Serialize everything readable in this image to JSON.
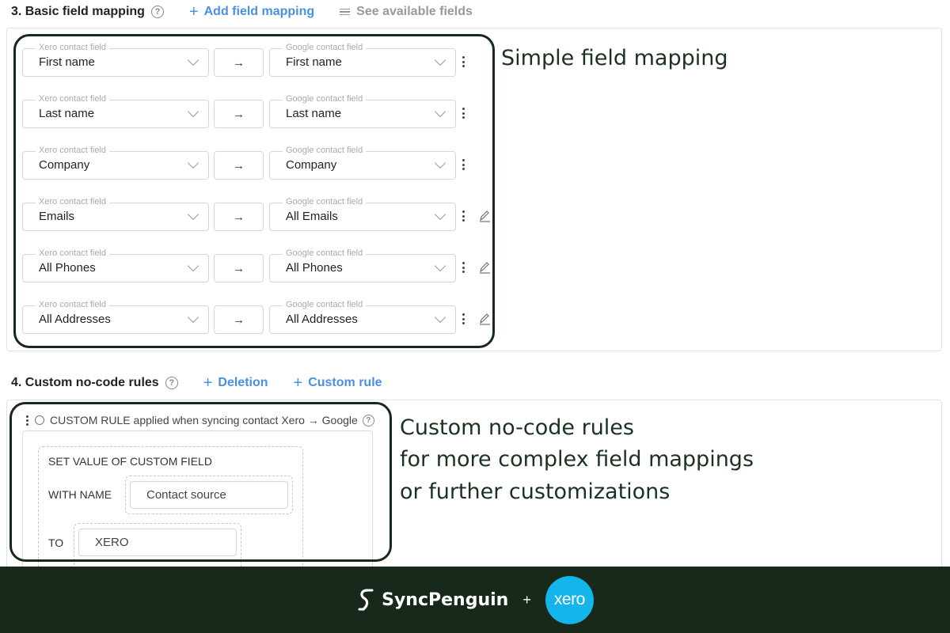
{
  "section3": {
    "title": "3. Basic field mapping",
    "help": "?",
    "add_link": "Add field mapping",
    "see_link": "See available fields"
  },
  "mapping": {
    "source_legend": "Xero contact field",
    "target_legend": "Google contact field",
    "arrow": "→",
    "rows": [
      {
        "source": "First name",
        "target": "First name",
        "editable": false
      },
      {
        "source": "Last name",
        "target": "Last name",
        "editable": false
      },
      {
        "source": "Company",
        "target": "Company",
        "editable": false
      },
      {
        "source": "Emails",
        "target": "All Emails",
        "editable": true
      },
      {
        "source": "All Phones",
        "target": "All Phones",
        "editable": true
      },
      {
        "source": "All Addresses",
        "target": "All Addresses",
        "editable": true
      }
    ]
  },
  "annotations": {
    "simple": "Simple field mapping",
    "custom_line1": "Custom no-code rules",
    "custom_line2": "for more complex field mappings",
    "custom_line3": "or further customizations"
  },
  "section4": {
    "title": "4. Custom no-code rules",
    "help": "?",
    "deletion_link": "Deletion",
    "custom_rule_link": "Custom rule"
  },
  "rule": {
    "header": "CUSTOM RULE applied when syncing contact Xero → Google",
    "set_value_label": "SET VALUE OF CUSTOM FIELD",
    "with_name_label": "WITH NAME",
    "name_value": "Contact source",
    "to_label": "TO",
    "to_value": "XERO"
  },
  "footer": {
    "brand": "SyncPenguin",
    "plus": "+",
    "partner_logo_text": "xero",
    "bg_color": "#18291b",
    "xero_color": "#13b5ea"
  },
  "colors": {
    "link_blue": "#4a90e2",
    "highlight_border": "#17291b",
    "annotation_text": "#1a3320"
  }
}
